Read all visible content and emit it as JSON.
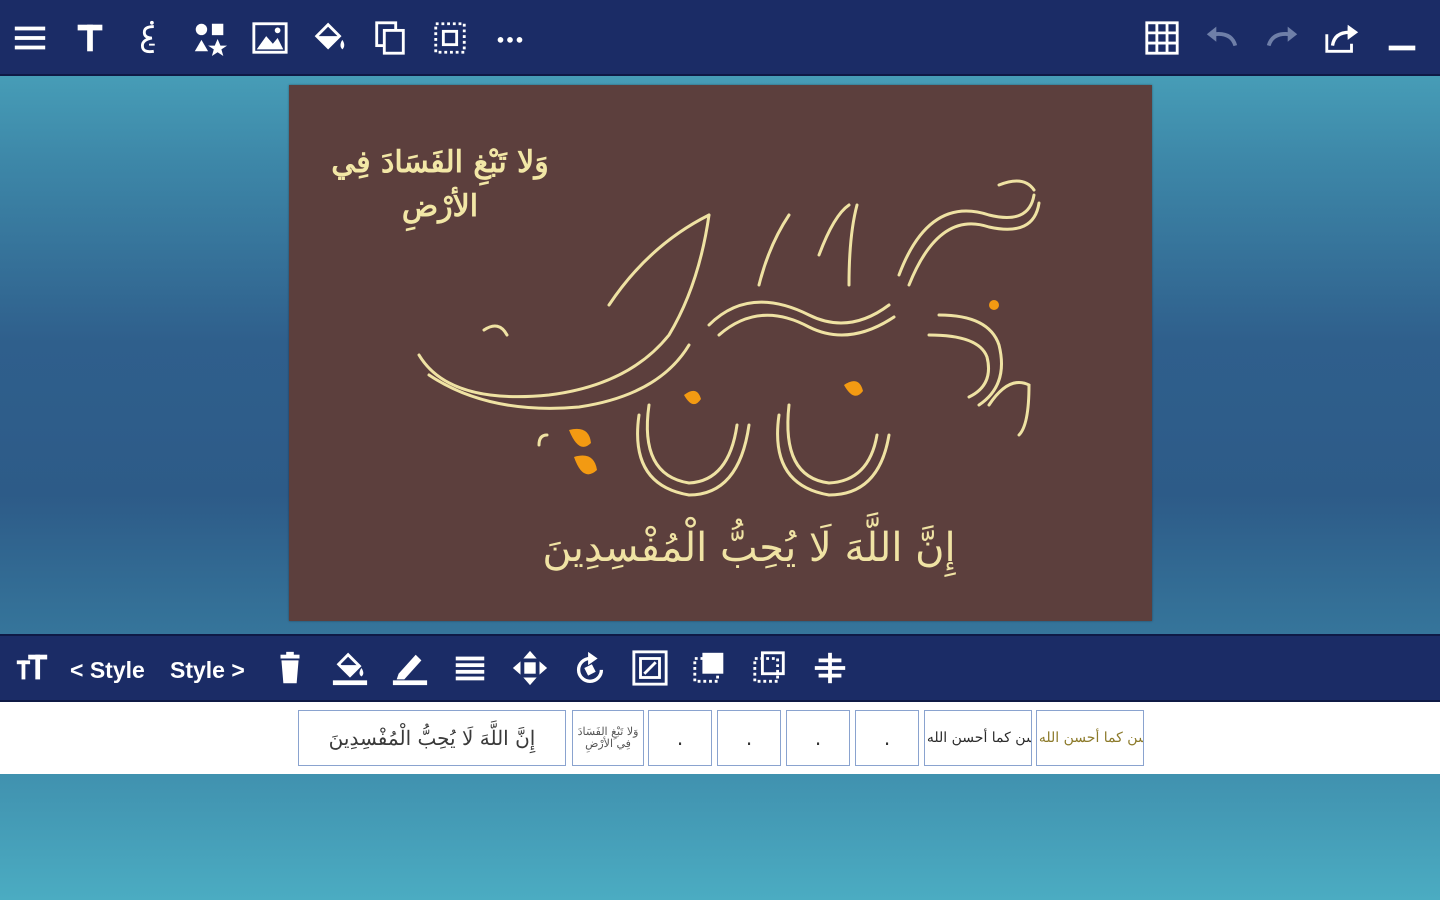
{
  "colors": {
    "toolbar_bg": "#1b2c66",
    "icon_white": "#ffffff",
    "icon_disabled": "#6f7fa8",
    "canvas_bg": "#5c3f3d",
    "calligraphy_cream": "#f0e3a4",
    "calligraphy_accent": "#f39a12"
  },
  "top_toolbar": {
    "left_icons": [
      "menu-icon",
      "text-icon",
      "arabic-letter-icon",
      "shapes-icon",
      "image-icon",
      "fill-bucket-icon",
      "copy-icon",
      "select-frame-icon",
      "more-icon"
    ],
    "right_icons": [
      "grid-icon",
      "undo-icon",
      "redo-icon",
      "share-icon",
      "minimize-icon"
    ]
  },
  "canvas": {
    "verse_top": "وَلا تَبْغِ الفَسَادَ فِي الأرْضِ",
    "verse_main": "وأحسن كما أحسن الله إليك",
    "verse_bottom": "إِنَّ اللَّهَ لَا يُحِبُّ الْمُفْسِدِينَ"
  },
  "edit_toolbar": {
    "style_prev_label": "< Style",
    "style_next_label": "Style >",
    "icons": [
      "font-size-icon",
      "trash-icon",
      "fill-color-icon",
      "stroke-color-icon",
      "align-icon",
      "move-icon",
      "rotate-icon",
      "resize-icon",
      "bring-forward-icon",
      "send-backward-icon",
      "align-center-icon"
    ]
  },
  "layer_strip": {
    "thumb_1": "إِنَّ اللَّهَ لَا يُحِبُّ الْمُفْسِدِينَ",
    "thumb_2": "وَلا تَبْغِ الفَسَادَ فِي الأرْضِ",
    "thumb_3": ".",
    "thumb_4": ".",
    "thumb_5": ".",
    "thumb_6": ".",
    "thumb_7": "وأحسن كما أحسن الله إليك",
    "thumb_8": "وأحسن كما أحسن الله إليك"
  }
}
